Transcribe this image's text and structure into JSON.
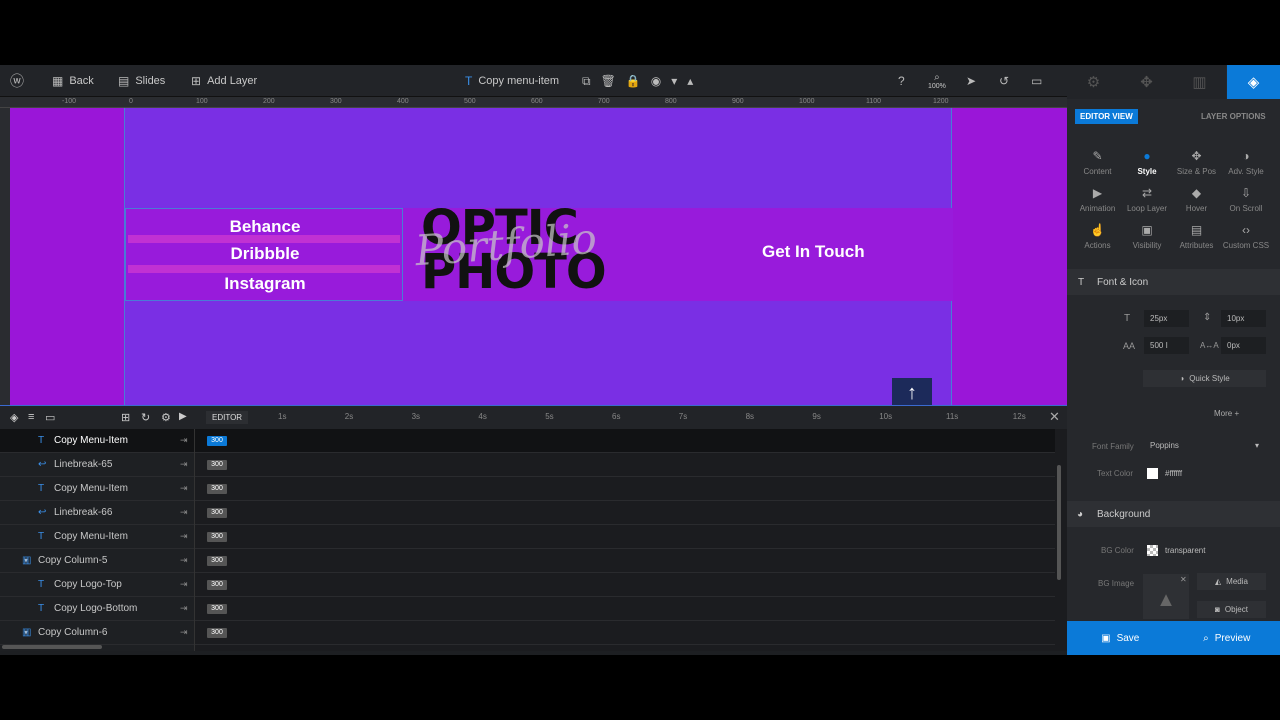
{
  "toolbar": {
    "back": "Back",
    "slides": "Slides",
    "add_layer": "Add Layer",
    "selected_layer": "Copy menu-item",
    "zoom": "100%"
  },
  "ruler": {
    "h": [
      "-100",
      "0",
      "100",
      "200",
      "300",
      "400",
      "500",
      "600",
      "700",
      "800",
      "900",
      "1000",
      "1100",
      "1200"
    ]
  },
  "canvas": {
    "menu_items": [
      "Behance",
      "Dribbble",
      "Instagram"
    ],
    "logo_top": "OPTIC",
    "logo_bottom": "PHOTO",
    "logo_script": "Portfolio",
    "cta": "Get In Touch",
    "bg_color": "#9a16d8",
    "stage_color": "#7a2fe4"
  },
  "timeline": {
    "editor_label": "EDITOR",
    "ticks": [
      "1s",
      "2s",
      "3s",
      "4s",
      "5s",
      "6s",
      "7s",
      "8s",
      "9s",
      "10s",
      "11s",
      "12s"
    ],
    "layers": [
      {
        "icon": "T",
        "name": "Copy Menu-Item",
        "value": "300",
        "active": true
      },
      {
        "icon": "↩",
        "name": "Linebreak-65",
        "value": "300"
      },
      {
        "icon": "T",
        "name": "Copy Menu-Item",
        "value": "300"
      },
      {
        "icon": "↩",
        "name": "Linebreak-66",
        "value": "300"
      },
      {
        "icon": "T",
        "name": "Copy Menu-Item",
        "value": "300"
      },
      {
        "icon": "▥",
        "name": "Copy Column-5",
        "value": "300",
        "group": true
      },
      {
        "icon": "T",
        "name": "Copy Logo-Top",
        "value": "300"
      },
      {
        "icon": "T",
        "name": "Copy Logo-Bottom",
        "value": "300"
      },
      {
        "icon": "▥",
        "name": "Copy Column-6",
        "value": "300",
        "group": true
      }
    ]
  },
  "panel": {
    "editor_view": "EDITOR VIEW",
    "layer_options": "LAYER OPTIONS",
    "options": [
      {
        "label": "Content",
        "icon": "✎"
      },
      {
        "label": "Style",
        "icon": "●"
      },
      {
        "label": "Size & Pos",
        "icon": "✥"
      },
      {
        "label": "Adv. Style",
        "icon": "◑"
      },
      {
        "label": "Animation",
        "icon": "▶"
      },
      {
        "label": "Loop Layer",
        "icon": "⇄"
      },
      {
        "label": "Hover",
        "icon": "◆"
      },
      {
        "label": "On Scroll",
        "icon": "⇩"
      },
      {
        "label": "Actions",
        "icon": "☝"
      },
      {
        "label": "Visibility",
        "icon": "▣"
      },
      {
        "label": "Attributes",
        "icon": "▤"
      },
      {
        "label": "Custom CSS",
        "icon": "‹›"
      }
    ],
    "font_section": "Font & Icon",
    "font_size": "25px",
    "line_height": "10px",
    "font_weight": "500 I",
    "letter_spacing": "0px",
    "quick_style": "Quick Style",
    "more": "More",
    "font_family_label": "Font Family",
    "font_family": "Poppins",
    "text_color_label": "Text Color",
    "text_color": "#ffffff",
    "bg_section": "Background",
    "bg_color_label": "BG Color",
    "bg_color": "transparent",
    "bg_image_label": "BG Image",
    "media": "Media",
    "object": "Object",
    "save": "Save",
    "preview": "Preview",
    "accent": "#0b7ad8"
  }
}
